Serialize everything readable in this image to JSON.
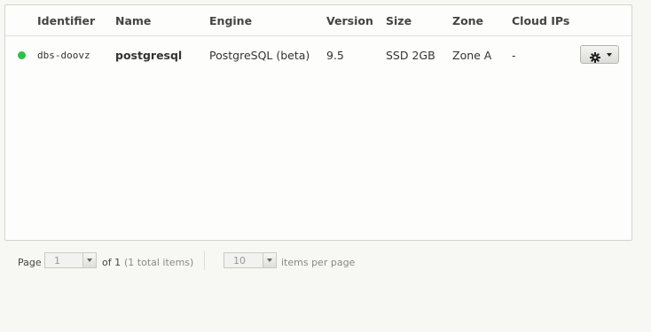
{
  "table": {
    "headers": {
      "identifier": "Identifier",
      "name": "Name",
      "engine": "Engine",
      "version": "Version",
      "size": "Size",
      "zone": "Zone",
      "cloud_ips": "Cloud IPs"
    },
    "rows": [
      {
        "status_color": "#2ec04b",
        "identifier": "dbs-doovz",
        "name": "postgresql",
        "engine": "PostgreSQL (beta)",
        "version": "9.5",
        "size": "SSD 2GB",
        "zone": "Zone A",
        "cloud_ips": "-",
        "actions_icon": "gear-icon"
      }
    ]
  },
  "pagination": {
    "page_label": "Page",
    "page_value": "1",
    "of_label": "of 1",
    "total_items": "(1 total items)",
    "per_page_value": "10",
    "per_page_label": "items per page"
  }
}
